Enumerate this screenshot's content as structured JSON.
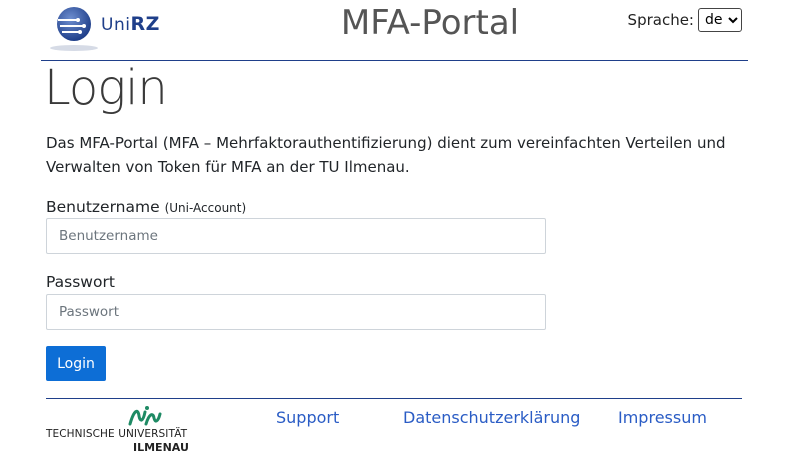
{
  "header": {
    "logo_prefix": "Uni",
    "logo_suffix": "RZ",
    "title": "MFA-Portal",
    "language_label": "Sprache:",
    "language_selected": "de"
  },
  "main": {
    "page_title": "Login",
    "intro": "Das MFA-Portal (MFA – Mehrfaktorauthentifizierung) dient zum vereinfachten Verteilen und Verwalten von Token für MFA an der TU Ilmenau.",
    "username_label": "Benutzername",
    "username_hint": "(Uni-Account)",
    "username_value": "",
    "username_placeholder": "Benutzername",
    "password_label": "Passwort",
    "password_value": "",
    "password_placeholder": "Passwort",
    "login_button": "Login"
  },
  "footer": {
    "university_line1": "TECHNISCHE UNIVERSITÄT",
    "university_line2": "ILMENAU",
    "links": [
      "Support",
      "Datenschutzerklärung",
      "Impressum"
    ]
  },
  "colors": {
    "brand_blue": "#1f3f8a",
    "button_blue": "#0d6ed6",
    "link_blue": "#2a5cc5"
  },
  "icons": {
    "unirz_logo": "globe-circuit-icon",
    "tu_logo": "tu-ilmenau-logo-icon",
    "language_dropdown": "chevron-down-icon"
  }
}
